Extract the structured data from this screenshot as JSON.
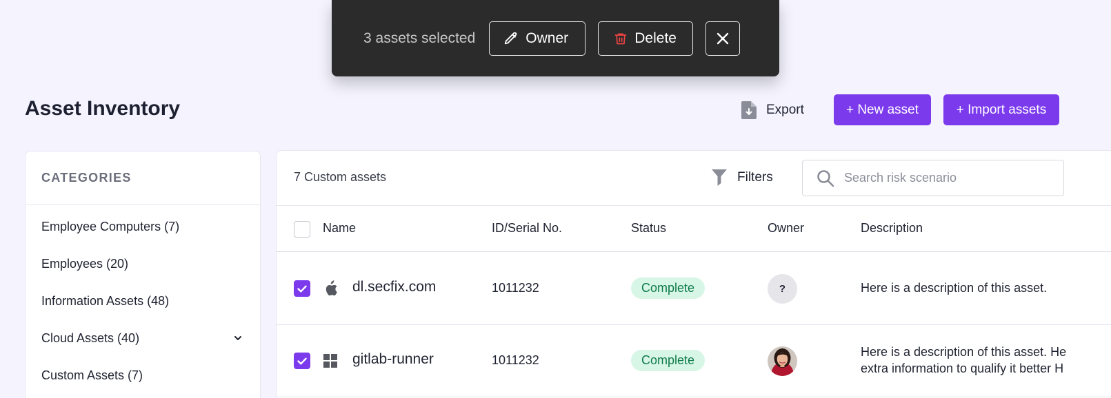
{
  "toast": {
    "count_label": "3 assets selected",
    "owner_label": "Owner",
    "delete_label": "Delete"
  },
  "header": {
    "title": "Asset Inventory",
    "export_label": "Export",
    "new_asset_label": "+ New asset",
    "import_label": "+ Import assets"
  },
  "categories": {
    "heading": "CATEGORIES",
    "items": [
      {
        "label": "Employee Computers (7)"
      },
      {
        "label": "Employees (20)"
      },
      {
        "label": "Information Assets (48)"
      },
      {
        "label": "Cloud Assets (40)",
        "expandable": true
      },
      {
        "label": "Custom Assets (7)"
      }
    ]
  },
  "table": {
    "count_label": "7 Custom assets",
    "filters_label": "Filters",
    "search_placeholder": "Search risk scenario",
    "columns": [
      "Name",
      "ID/Serial No.",
      "Status",
      "Owner",
      "Description"
    ],
    "rows": [
      {
        "checked": true,
        "os_icon": "apple-icon",
        "name": "dl.secfix.com",
        "id": "1011232",
        "status": "Complete",
        "owner": "?",
        "description_lines": [
          "Here is a description of this asset."
        ]
      },
      {
        "checked": true,
        "os_icon": "windows-icon",
        "name": "gitlab-runner",
        "id": "1011232",
        "status": "Complete",
        "owner": "avatar-photo",
        "description_lines": [
          "Here is a description of this asset. He",
          "extra information to qualify it better H"
        ]
      }
    ]
  },
  "colors": {
    "accent": "#7c3aed",
    "status_complete_bg": "#d7f6e6",
    "status_complete_text": "#0e7a4a",
    "toast_bg": "#2b2b2b",
    "delete_icon": "#ef4444"
  }
}
